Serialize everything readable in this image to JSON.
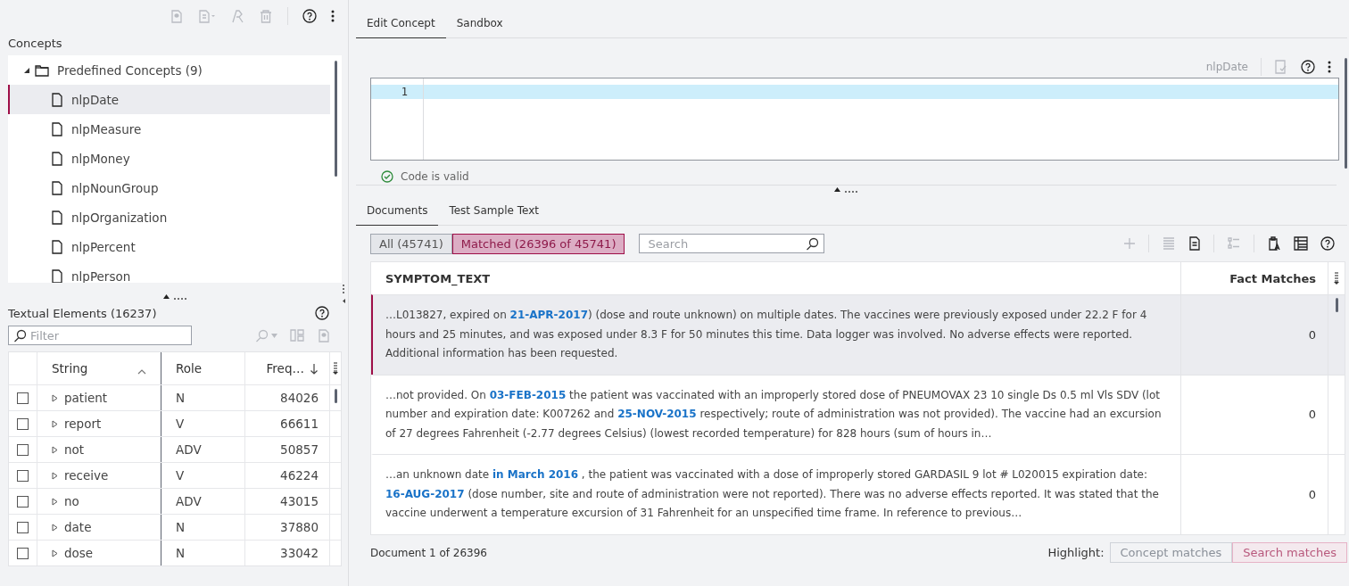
{
  "concepts_panel": {
    "title": "Concepts",
    "tree": [
      {
        "label": "Predefined Concepts (9)",
        "expanded": true,
        "children": [
          {
            "label": "nlpDate",
            "selected": true
          },
          {
            "label": "nlpMeasure",
            "selected": false
          },
          {
            "label": "nlpMoney",
            "selected": false
          },
          {
            "label": "nlpNounGroup",
            "selected": false
          },
          {
            "label": "nlpOrganization",
            "selected": false
          },
          {
            "label": "nlpPercent",
            "selected": false
          },
          {
            "label": "nlpPerson",
            "selected": false
          }
        ]
      }
    ]
  },
  "textual_elements": {
    "title": "Textual Elements (16237)",
    "filter": {
      "placeholder": "Filter"
    },
    "columns": [
      "String",
      "Role",
      "Freq…"
    ],
    "rows": [
      {
        "string": "patient",
        "role": "N",
        "frequency": "84026",
        "checked": false
      },
      {
        "string": "report",
        "role": "V",
        "frequency": "66611",
        "checked": false
      },
      {
        "string": "not",
        "role": "ADV",
        "frequency": "50857",
        "checked": false
      },
      {
        "string": "receive",
        "role": "V",
        "frequency": "46224",
        "checked": false
      },
      {
        "string": "no",
        "role": "ADV",
        "frequency": "43015",
        "checked": false
      },
      {
        "string": "date",
        "role": "N",
        "frequency": "37880",
        "checked": false
      },
      {
        "string": "dose",
        "role": "N",
        "frequency": "33042",
        "checked": false
      }
    ]
  },
  "tabs": [
    {
      "label": "Edit Concept",
      "selected": true
    },
    {
      "label": "Sandbox",
      "selected": false
    }
  ],
  "editor": {
    "concept": "nlpDate",
    "line_numbers": [
      "1"
    ],
    "status": "Code is valid"
  },
  "document_tabs": [
    {
      "label": "Documents",
      "selected": true
    },
    {
      "label": "Test Sample Text",
      "selected": false
    }
  ],
  "filters": [
    {
      "label": "All (45741)",
      "selected": false
    },
    {
      "label": "Matched (26396 of 45741)",
      "selected": true
    }
  ],
  "search": {
    "placeholder": "Search"
  },
  "documents": {
    "columns": [
      "SYMPTOM_TEXT",
      "Fact Matches"
    ],
    "rows": [
      {
        "text": "…L013827, expired on **21-APR-2017**) (dose and route unknown) on multiple dates. The vaccines were previously exposed under 22.2 F for 4 hours and 25 minutes, and was exposed under 8.3 F for 50 minutes this time. Data logger was involved. No adverse effects were reported. Additional information has been requested.",
        "fact_matches": "0",
        "selected": true
      },
      {
        "text": "…not provided. On **03-FEB-2015** the patient was vaccinated with an improperly stored dose of PNEUMOVAX 23 10 single Ds 0.5 ml Vls SDV (lot number and expiration date: K007262 and **25-NOV-2015** respectively; route of administration was not provided). The vaccine had an excursion of 27 degrees Fahrenheit (-2.77 degrees Celsius) (lowest recorded temperature) for 828 hours (sum of hours in…",
        "fact_matches": "0",
        "selected": false
      },
      {
        "text": "…an unknown date **in March 2016** , the patient was vaccinated with a dose of improperly stored GARDASIL 9 lot # L020015 expiration date: **16-AUG-2017** (dose number, site and route of administration were not reported). There was no adverse effects reported. It was stated that the vaccine underwent a temperature excursion of 31 Fahrenheit for an unspecified time frame. In reference to previous…",
        "fact_matches": "0",
        "selected": false
      }
    ]
  },
  "footer": {
    "position": "Document 1 of 26396",
    "highlight_label": "Highlight:",
    "highlight_buttons": [
      {
        "label": "Concept matches",
        "kind": "concept"
      },
      {
        "label": "Search matches",
        "kind": "search"
      }
    ]
  }
}
